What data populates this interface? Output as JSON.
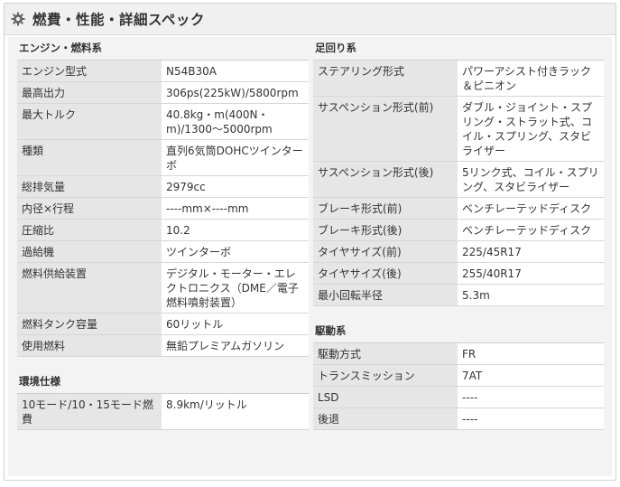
{
  "header": {
    "title": "燃費・性能・詳細スペック",
    "icon": "gear-icon"
  },
  "left": {
    "engine": {
      "title": "エンジン・燃料系",
      "rows": [
        {
          "k": "エンジン型式",
          "v": "N54B30A"
        },
        {
          "k": "最高出力",
          "v": "306ps(225kW)/5800rpm"
        },
        {
          "k": "最大トルク",
          "v": "40.8kg・m(400N・m)/1300〜5000rpm"
        },
        {
          "k": "種類",
          "v": "直列6気筒DOHCツインターボ"
        },
        {
          "k": "総排気量",
          "v": "2979cc"
        },
        {
          "k": "内径×行程",
          "v": "----mm×----mm"
        },
        {
          "k": "圧縮比",
          "v": "10.2"
        },
        {
          "k": "過給機",
          "v": "ツインターボ"
        },
        {
          "k": "燃料供給装置",
          "v": "デジタル・モーター・エレクトロニクス（DME／電子燃料噴射装置）"
        },
        {
          "k": "燃料タンク容量",
          "v": "60リットル"
        },
        {
          "k": "使用燃料",
          "v": "無鉛プレミアムガソリン"
        }
      ]
    },
    "env": {
      "title": "環境仕様",
      "rows": [
        {
          "k": "10モード/10・15モード燃費",
          "v": "8.9km/リットル"
        }
      ]
    }
  },
  "right": {
    "chassis": {
      "title": "足回り系",
      "rows": [
        {
          "k": "ステアリング形式",
          "v": "パワーアシスト付きラック＆ピニオン"
        },
        {
          "k": "サスペンション形式(前)",
          "v": "ダブル・ジョイント・スプリング・ストラット式、コイル・スプリング、スタビライザー"
        },
        {
          "k": "サスペンション形式(後)",
          "v": "5リンク式、コイル・スプリング、スタビライザー"
        },
        {
          "k": "ブレーキ形式(前)",
          "v": "ベンチレーテッドディスク"
        },
        {
          "k": "ブレーキ形式(後)",
          "v": "ベンチレーテッドディスク"
        },
        {
          "k": "タイヤサイズ(前)",
          "v": "225/45R17"
        },
        {
          "k": "タイヤサイズ(後)",
          "v": "255/40R17"
        },
        {
          "k": "最小回転半径",
          "v": "5.3m"
        }
      ]
    },
    "drive": {
      "title": "駆動系",
      "rows": [
        {
          "k": "駆動方式",
          "v": "FR"
        },
        {
          "k": "トランスミッション",
          "v": "7AT"
        },
        {
          "k": "LSD",
          "v": "----"
        },
        {
          "k": "後退",
          "v": "----"
        }
      ]
    }
  }
}
